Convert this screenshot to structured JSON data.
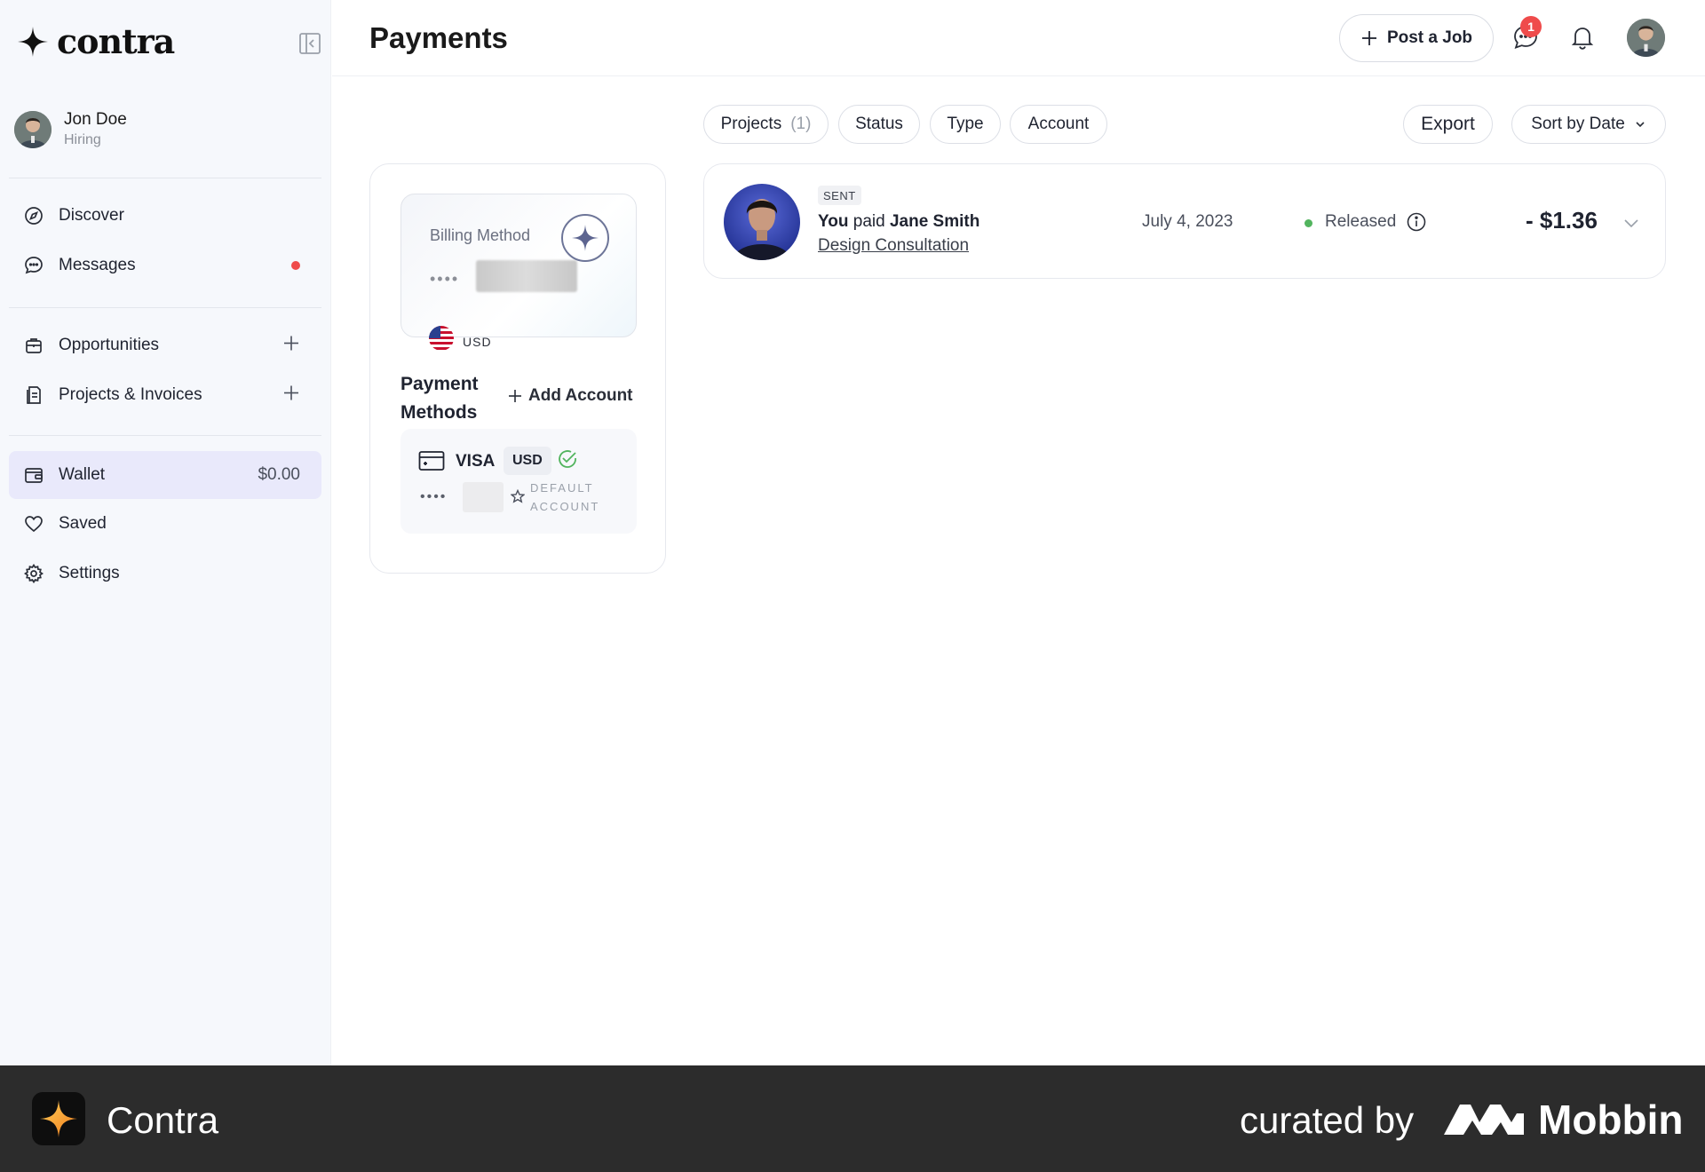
{
  "app": {
    "name": "contra"
  },
  "user": {
    "name": "Jon Doe",
    "role": "Hiring"
  },
  "nav": {
    "discover": "Discover",
    "messages": "Messages",
    "opportunities": "Opportunities",
    "projects_invoices": "Projects & Invoices",
    "wallet": "Wallet",
    "wallet_amount": "$0.00",
    "saved": "Saved",
    "settings": "Settings"
  },
  "header": {
    "title": "Payments",
    "post_job": "Post a Job",
    "notification_count": "1"
  },
  "filters": {
    "projects": "Projects",
    "projects_count": "(1)",
    "status": "Status",
    "type": "Type",
    "account": "Account",
    "export": "Export",
    "sort": "Sort by Date"
  },
  "billing": {
    "card_title": "Billing Method",
    "masked": "••••",
    "currency": "USD",
    "payment_methods_title": "Payment Methods",
    "add_account": "Add Account",
    "visa": {
      "brand": "VISA",
      "currency": "USD",
      "masked": "••••",
      "default_label": "DEFAULT ACCOUNT"
    }
  },
  "transactions": [
    {
      "tag": "SENT",
      "prefix": "You",
      "verb": "paid",
      "payee": "Jane Smith",
      "project": "Design Consultation",
      "date": "July 4, 2023",
      "status": "Released",
      "amount": "- $1.36"
    }
  ],
  "footer": {
    "brand": "Contra",
    "curated_by": "curated by",
    "curator": "Mobbin"
  },
  "colors": {
    "sidebar_bg": "#f6f8fc",
    "wallet_active": "#e9e9fb",
    "alert_red": "#ef4b4b",
    "released_green": "#52b45e",
    "footer_bg": "#2c2c2c"
  }
}
